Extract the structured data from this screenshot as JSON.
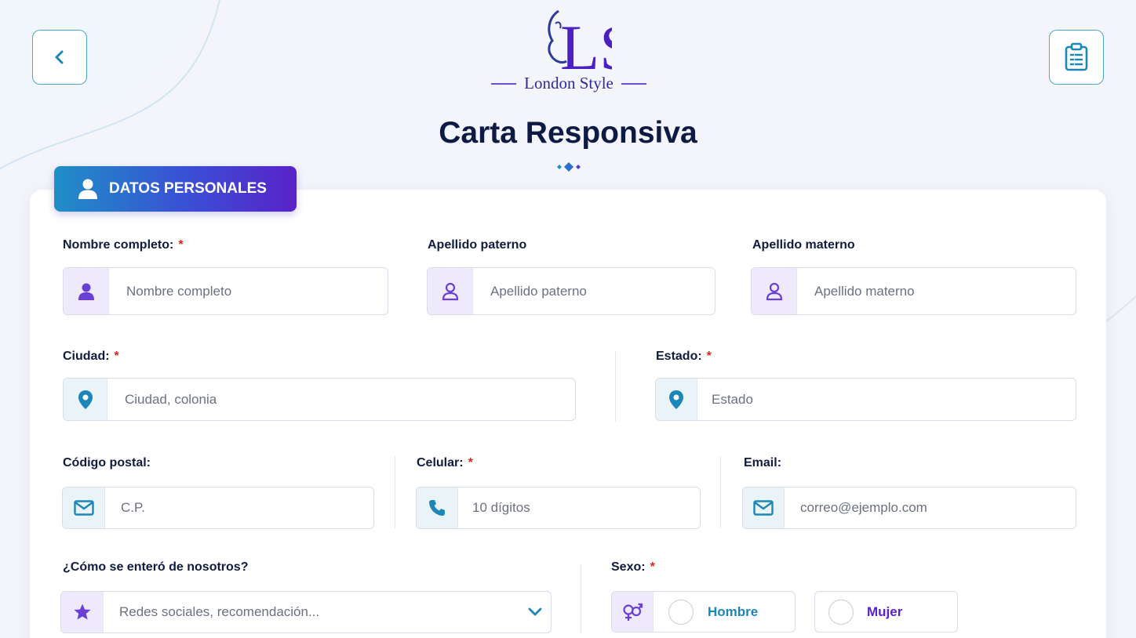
{
  "header": {
    "brand_name": "London Style",
    "logo_monogram": "LS",
    "title": "Carta Responsiva",
    "back_icon": "chevron-left-icon",
    "clipboard_icon": "clipboard-list-icon"
  },
  "section": {
    "label": "DATOS PERSONALES",
    "icon": "user-icon"
  },
  "fields": {
    "nombre": {
      "label": "Nombre completo:",
      "required": "*",
      "placeholder": "Nombre completo",
      "icon": "user-solid-icon"
    },
    "paterno": {
      "label": "Apellido paterno",
      "placeholder": "Apellido paterno",
      "icon": "user-outline-icon"
    },
    "materno": {
      "label": "Apellido materno",
      "placeholder": "Apellido materno",
      "icon": "user-outline-icon"
    },
    "ciudad": {
      "label": "Ciudad:",
      "required": "*",
      "placeholder": "Ciudad, colonia",
      "icon": "map-pin-icon"
    },
    "estado": {
      "label": "Estado:",
      "required": "*",
      "placeholder": "Estado",
      "icon": "map-pin-icon"
    },
    "cp": {
      "label": "Código postal:",
      "placeholder": "C.P.",
      "icon": "envelope-icon"
    },
    "celular": {
      "label": "Celular:",
      "required": "*",
      "placeholder": "10 dígitos",
      "icon": "phone-icon"
    },
    "email": {
      "label": "Email:",
      "placeholder": "correo@ejemplo.com",
      "icon": "envelope-icon"
    },
    "referencia": {
      "label": "¿Cómo se enteró de nosotros?",
      "placeholder": "Redes sociales, recomendación...",
      "icon": "star-icon"
    },
    "sexo": {
      "label": "Sexo:",
      "required": "*",
      "icon": "gender-icon",
      "options": [
        "Hombre",
        "Mujer"
      ]
    }
  },
  "colors": {
    "accent_blue": "#1f8fc7",
    "accent_purple": "#5a22c8",
    "required_red": "#e02424",
    "hombre_text": "#1b86b8",
    "mujer_text": "#5a22c8"
  }
}
